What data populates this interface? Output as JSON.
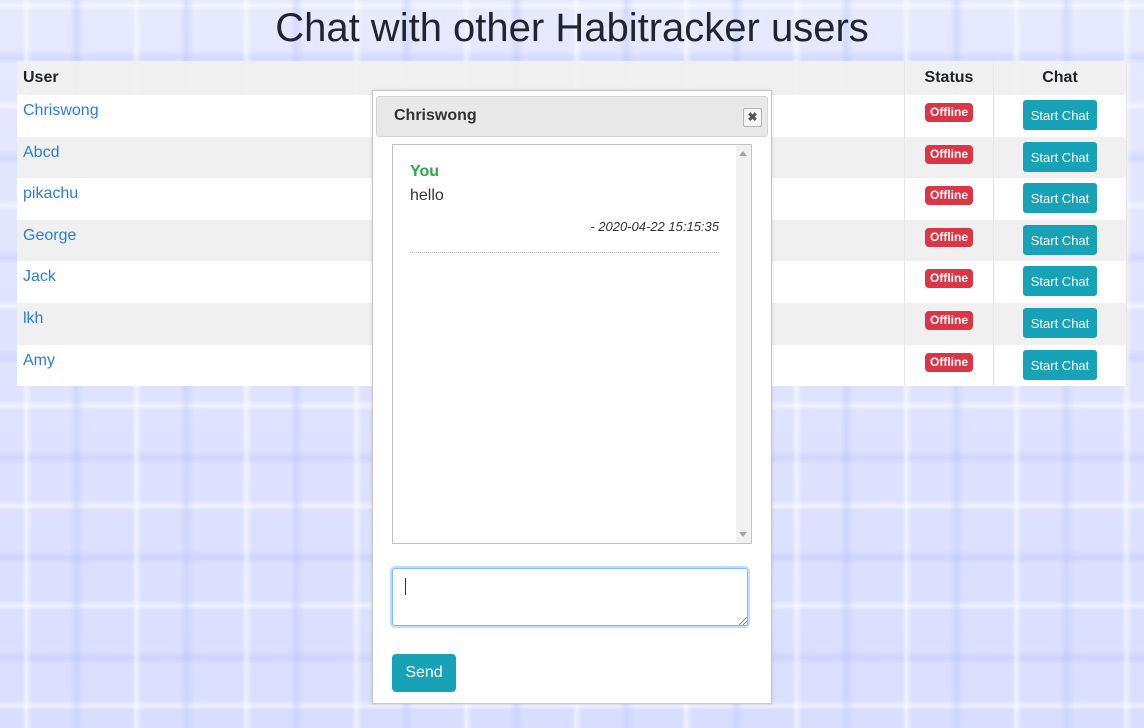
{
  "page": {
    "title": "Chat with other Habitracker users"
  },
  "table": {
    "headers": {
      "user": "User",
      "status": "Status",
      "chat": "Chat"
    },
    "rows": [
      {
        "user": "Chriswong",
        "status": "Offline",
        "action": "Start Chat"
      },
      {
        "user": "Abcd",
        "status": "Offline",
        "action": "Start Chat"
      },
      {
        "user": "pikachu",
        "status": "Offline",
        "action": "Start Chat"
      },
      {
        "user": "George",
        "status": "Offline",
        "action": "Start Chat"
      },
      {
        "user": "Jack",
        "status": "Offline",
        "action": "Start Chat"
      },
      {
        "user": "lkh",
        "status": "Offline",
        "action": "Start Chat"
      },
      {
        "user": "Amy",
        "status": "Offline",
        "action": "Start Chat"
      }
    ]
  },
  "chat_modal": {
    "title": "Chriswong",
    "close_icon": "close-icon",
    "messages": [
      {
        "sender": "You",
        "text": "hello",
        "time": "- 2020-04-22 15:15:35"
      }
    ],
    "input_value": "",
    "send_label": "Send"
  },
  "colors": {
    "link": "#2a7de1",
    "offline_badge": "#dc3545",
    "primary_button": "#17a2b8",
    "sender_name": "#28a745"
  }
}
